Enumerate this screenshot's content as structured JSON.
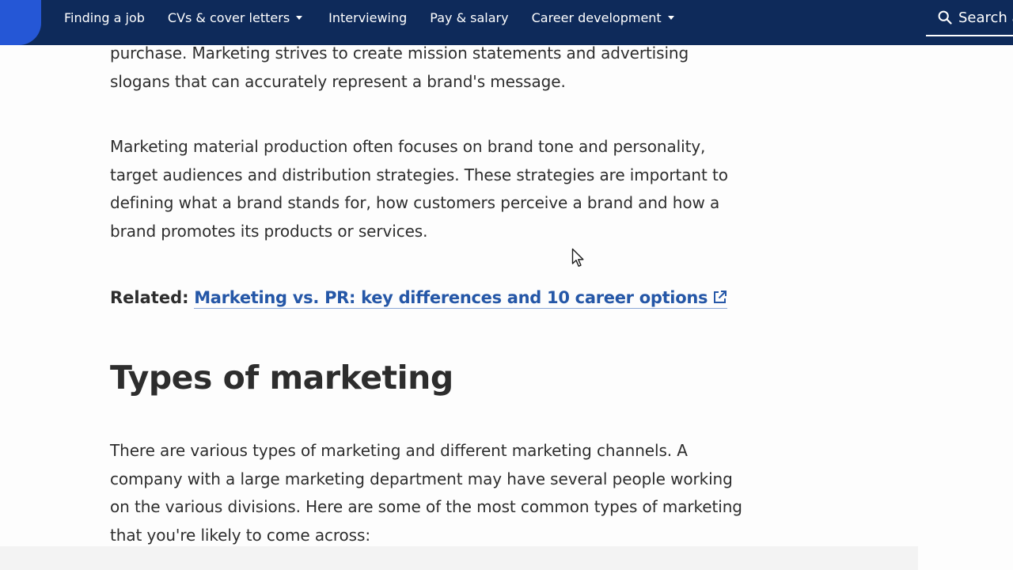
{
  "nav": {
    "items": [
      {
        "label": "Finding a job",
        "dropdown": false
      },
      {
        "label": "CVs & cover letters",
        "dropdown": true
      },
      {
        "label": "Interviewing",
        "dropdown": false
      },
      {
        "label": "Pay & salary",
        "dropdown": false
      },
      {
        "label": "Career development",
        "dropdown": true
      }
    ],
    "search_label": "Search a"
  },
  "article": {
    "paragraph_1": "purchase. Marketing strives to create mission statements and advertising slogans that can accurately represent a brand's message.",
    "paragraph_2": "Marketing material production often focuses on brand tone and personality, target audiences and distribution strategies. These strategies are important to defining what a brand stands for, how customers perceive a brand and how a brand promotes its products or services.",
    "related_label": "Related:",
    "related_link": "Marketing vs. PR: key differences and 10 career options",
    "section_title": "Types of marketing",
    "paragraph_3": "There are various types of marketing and different marketing channels. A company with a large marketing department may have several people working on the various divisions. Here are some of the most common types of marketing that you're likely to come across:"
  },
  "colors": {
    "navbar": "#0e2a5a",
    "accent": "#2557d6",
    "link": "#2557a7",
    "text": "#2d2d2d"
  },
  "icons": [
    "search-icon",
    "caret-down-icon",
    "external-link-icon",
    "mouse-cursor-icon"
  ]
}
